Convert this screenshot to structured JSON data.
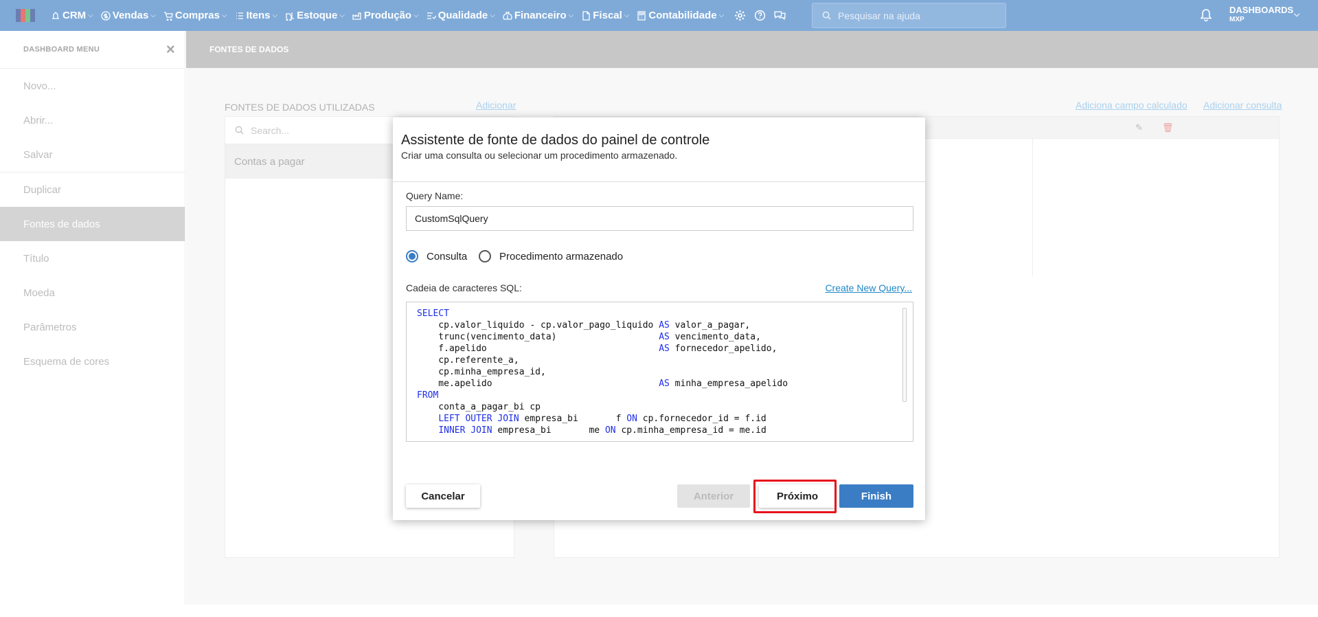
{
  "topbar": {
    "nav": [
      {
        "label": "CRM",
        "icon": "crm-icon"
      },
      {
        "label": "Vendas",
        "icon": "dollar-circle-icon"
      },
      {
        "label": "Compras",
        "icon": "cart-icon"
      },
      {
        "label": "Itens",
        "icon": "list-icon"
      },
      {
        "label": "Estoque",
        "icon": "forklift-icon"
      },
      {
        "label": "Produção",
        "icon": "factory-icon"
      },
      {
        "label": "Qualidade",
        "icon": "checklist-icon"
      },
      {
        "label": "Financeiro",
        "icon": "money-bag-icon"
      },
      {
        "label": "Fiscal",
        "icon": "document-icon"
      },
      {
        "label": "Contabilidade",
        "icon": "calculator-icon"
      }
    ],
    "search_placeholder": "Pesquisar na ajuda",
    "dashboard_label": "DASHBOARDS",
    "dashboard_sub": "MXP",
    "colors": {
      "bar": "#3b7dc4"
    }
  },
  "sidebar": {
    "title": "DASHBOARD MENU",
    "items": [
      "Novo...",
      "Abrir...",
      "Salvar",
      "Duplicar",
      "Fontes de dados",
      "Título",
      "Moeda",
      "Parâmetros",
      "Esquema de cores"
    ],
    "active": "Fontes de dados"
  },
  "main": {
    "header": "FONTES DE DADOS",
    "used_title": "FONTES DE DADOS UTILIZADAS",
    "add_link": "Adicionar",
    "add_calc_link": "Adiciona campo calculado",
    "add_query_link": "Adicionar consulta",
    "search_placeholder": "Search...",
    "sources": [
      "Contas a pagar"
    ]
  },
  "dialog": {
    "title": "Assistente de fonte de dados do painel de controle",
    "subtitle": "Criar uma consulta ou selecionar um procedimento armazenado.",
    "query_name_label": "Query Name:",
    "query_name_value": "CustomSqlQuery",
    "radio_query": "Consulta",
    "radio_procedure": "Procedimento armazenado",
    "selected": "Consulta",
    "sql_label": "Cadeia de caracteres SQL:",
    "create_link": "Create New Query...",
    "buttons": {
      "cancel": "Cancelar",
      "previous": "Anterior",
      "next": "Próximo",
      "finish": "Finish"
    }
  }
}
